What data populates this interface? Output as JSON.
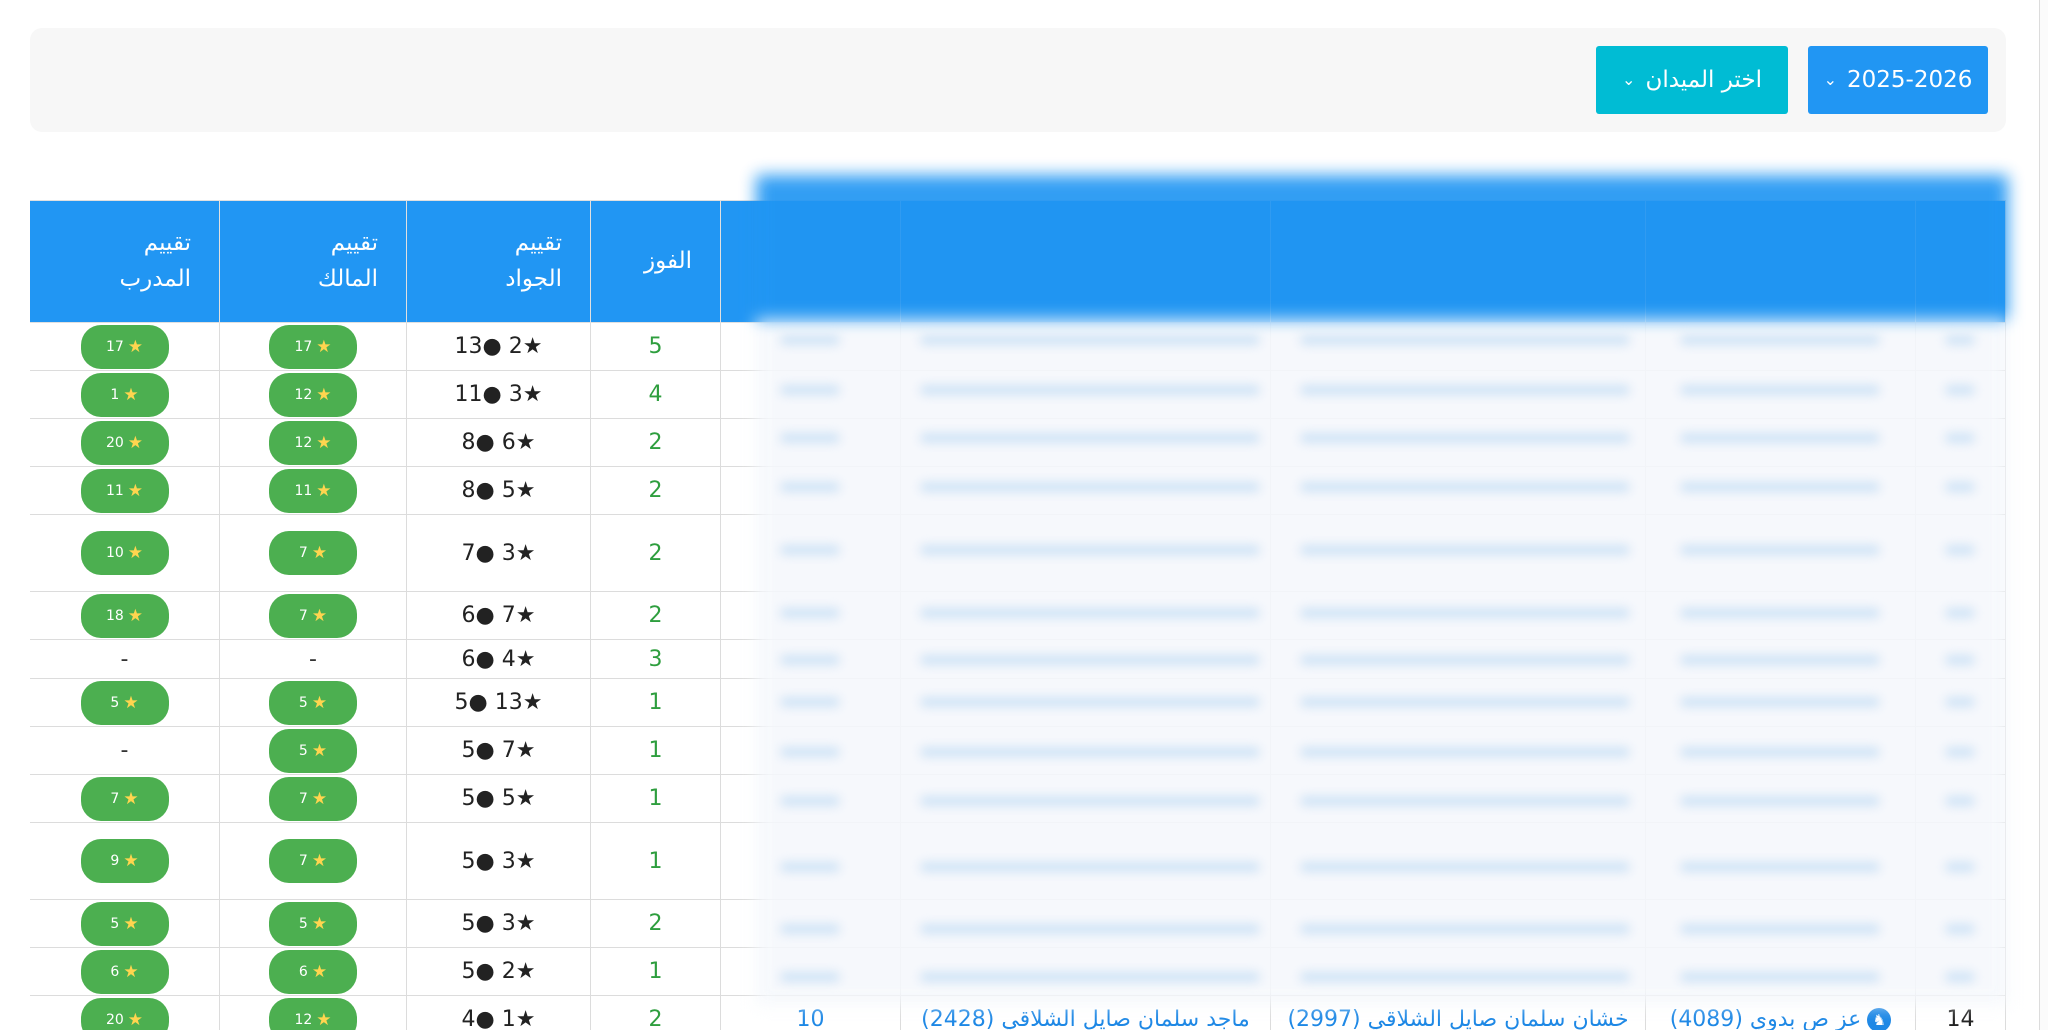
{
  "filters": {
    "year_label": "2025-2026",
    "field_label": "اختر الميدان"
  },
  "table": {
    "headers": {
      "rank": "",
      "horse": "",
      "owner": "",
      "trainer": "",
      "runs": "",
      "wins": "الفوز",
      "horse_rating_line1": "تقييم",
      "horse_rating_line2": "الجواد",
      "owner_rating_line1": "تقييم",
      "owner_rating_line2": "المالك",
      "trainer_rating_line1": "تقييم",
      "trainer_rating_line2": "المدرب"
    },
    "rows": [
      {
        "wins": "5",
        "horse_rating": "13● 2★",
        "owner_rating": "17",
        "trainer_rating": "17"
      },
      {
        "wins": "4",
        "horse_rating": "11● 3★",
        "owner_rating": "12",
        "trainer_rating": "1"
      },
      {
        "wins": "2",
        "horse_rating": "8● 6★",
        "owner_rating": "12",
        "trainer_rating": "20"
      },
      {
        "wins": "2",
        "horse_rating": "8● 5★",
        "owner_rating": "11",
        "trainer_rating": "11"
      },
      {
        "wins": "2",
        "horse_rating": "7● 3★",
        "owner_rating": "7",
        "trainer_rating": "10"
      },
      {
        "wins": "2",
        "horse_rating": "6● 7★",
        "owner_rating": "7",
        "trainer_rating": "18"
      },
      {
        "wins": "3",
        "horse_rating": "6● 4★",
        "owner_rating": "-",
        "trainer_rating": "-"
      },
      {
        "wins": "1",
        "horse_rating": "5● 13★",
        "owner_rating": "5",
        "trainer_rating": "5"
      },
      {
        "wins": "1",
        "horse_rating": "5● 7★",
        "owner_rating": "5",
        "trainer_rating": "-"
      },
      {
        "wins": "1",
        "horse_rating": "5● 5★",
        "owner_rating": "7",
        "trainer_rating": "7"
      },
      {
        "wins": "1",
        "horse_rating": "5● 3★",
        "owner_rating": "7",
        "trainer_rating": "9"
      },
      {
        "wins": "2",
        "horse_rating": "5● 3★",
        "owner_rating": "5",
        "trainer_rating": "5"
      },
      {
        "wins": "1",
        "horse_rating": "5● 2★",
        "owner_rating": "6",
        "trainer_rating": "6"
      },
      {
        "rank": "14",
        "horse": "عز ص بدوي (4089)",
        "owner": "خشان سلمان صايل الشلاقي (2997)",
        "trainer": "ماجد سلمان صايل الشلاقي (2428)",
        "runs": "10",
        "wins": "2",
        "horse_rating": "4● 1★",
        "owner_rating": "12",
        "trainer_rating": "20"
      }
    ]
  }
}
